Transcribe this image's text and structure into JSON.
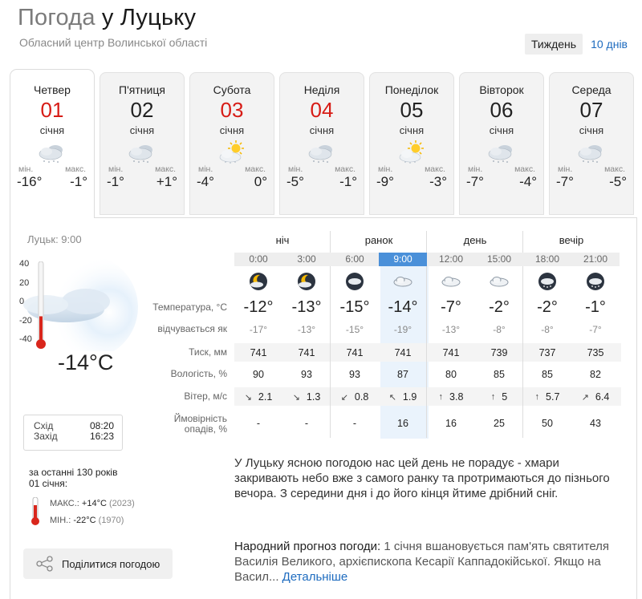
{
  "title": {
    "prefix": "Погода",
    "city": "у Луцьку"
  },
  "subtitle": "Обласний центр Волинської області",
  "period_switch": {
    "week": "Тиждень",
    "ten_days": "10 днів"
  },
  "days": [
    {
      "dow": "Четвер",
      "day": "01",
      "month": "січня",
      "icon": "cloud-snow-icon",
      "min_label": "мін.",
      "max_label": "макс.",
      "min": "-16°",
      "max": "-1°"
    },
    {
      "dow": "П'ятниця",
      "day": "02",
      "month": "січня",
      "icon": "cloud-snow-icon",
      "min_label": "мін.",
      "max_label": "макс.",
      "min": "-1°",
      "max": "+1°"
    },
    {
      "dow": "Субота",
      "day": "03",
      "month": "січня",
      "icon": "sun-cloud-icon",
      "min_label": "мін.",
      "max_label": "макс.",
      "min": "-4°",
      "max": "0°"
    },
    {
      "dow": "Неділя",
      "day": "04",
      "month": "січня",
      "icon": "cloud-snow-icon",
      "min_label": "мін.",
      "max_label": "макс.",
      "min": "-5°",
      "max": "-1°"
    },
    {
      "dow": "Понеділок",
      "day": "05",
      "month": "січня",
      "icon": "sun-cloud-icon",
      "min_label": "мін.",
      "max_label": "макс.",
      "min": "-9°",
      "max": "-3°"
    },
    {
      "dow": "Вівторок",
      "day": "06",
      "month": "січня",
      "icon": "cloud-snow-icon",
      "min_label": "мін.",
      "max_label": "макс.",
      "min": "-7°",
      "max": "-4°"
    },
    {
      "dow": "Середа",
      "day": "07",
      "month": "січня",
      "icon": "cloud-snow-icon",
      "min_label": "мін.",
      "max_label": "макс.",
      "min": "-7°",
      "max": "-5°"
    }
  ],
  "now": {
    "label": "Луцьк: 9:00",
    "temp": "-14°C",
    "scale": [
      "40",
      "20",
      "0",
      "-20",
      "-40"
    ],
    "thermometer_level": -14
  },
  "sun": {
    "rise_label": "Схід",
    "rise": "08:20",
    "set_label": "Захід",
    "set": "16:23"
  },
  "history": {
    "title_line1": "за останні 130 років",
    "title_line2": "01 січня:",
    "max_label": "МАКС.:",
    "max": "+14°C",
    "max_year": "(2023)",
    "min_label": "МІН.:",
    "min": "-22°C",
    "min_year": "(1970)"
  },
  "share": {
    "label": "Поділитися погодою"
  },
  "periods": [
    "ніч",
    "ранок",
    "день",
    "вечір"
  ],
  "hours": [
    "0:00",
    "3:00",
    "6:00",
    "9:00",
    "12:00",
    "15:00",
    "18:00",
    "21:00"
  ],
  "hour_icons": [
    "moon-cloud-icon",
    "moon-cloud-icon",
    "cloud-icon",
    "cloud-icon",
    "cloud-icon",
    "cloud-icon",
    "cloud-snow-icon",
    "cloud-snow-icon"
  ],
  "labels": {
    "temp": "Температура, °C",
    "feel": "відчувається як",
    "pressure": "Тиск, мм",
    "humidity": "Вологість, %",
    "wind": "Вітер, м/с",
    "precip": "Ймовірність опадів, %"
  },
  "temps": [
    "-12°",
    "-13°",
    "-15°",
    "-14°",
    "-7°",
    "-2°",
    "-2°",
    "-1°"
  ],
  "feels": [
    "-17°",
    "-13°",
    "-15°",
    "-19°",
    "-13°",
    "-8°",
    "-8°",
    "-7°"
  ],
  "pressure": [
    "741",
    "741",
    "741",
    "741",
    "741",
    "739",
    "737",
    "735"
  ],
  "humidity": [
    "90",
    "93",
    "93",
    "87",
    "80",
    "85",
    "85",
    "82"
  ],
  "wind": [
    {
      "dir": "↘",
      "v": "2.1"
    },
    {
      "dir": "↘",
      "v": "1.3"
    },
    {
      "dir": "↙",
      "v": "0.8"
    },
    {
      "dir": "↖",
      "v": "1.9"
    },
    {
      "dir": "↑",
      "v": "3.8"
    },
    {
      "dir": "↑",
      "v": "5"
    },
    {
      "dir": "↑",
      "v": "5.7"
    },
    {
      "dir": "↗",
      "v": "6.4"
    }
  ],
  "precip": [
    "-",
    "-",
    "-",
    "16",
    "16",
    "25",
    "50",
    "43"
  ],
  "description": "У Луцьку ясною погодою нас цей день не порадує - хмари закривають небо вже з самого ранку та протримаються до пізнього вечора. З середини дня і до його кінця йтиме дрібний сніг.",
  "folk": {
    "label": "Народний прогноз погоди:",
    "text": " 1 січня вшановується пам'ять святителя Василія Великого, архієпископа Кесарії Каппадокійської. Якщо на Васил... ",
    "link": "Детальніше"
  },
  "colors": {
    "accent": "#4a90d9",
    "link": "#1d6bbf",
    "red": "#d71c16",
    "mercury": "#d9261c"
  }
}
